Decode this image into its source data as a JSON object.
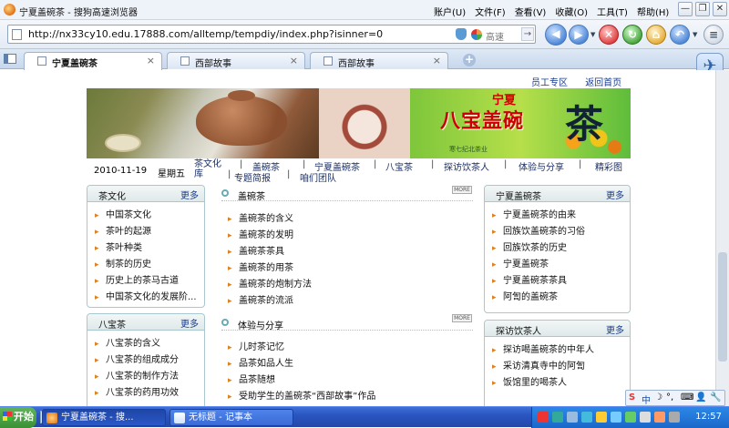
{
  "window": {
    "title": "宁夏盖碗茶 - 搜狗高速浏览器",
    "menus": [
      "账户(U)",
      "文件(F)",
      "查看(V)",
      "收藏(O)",
      "工具(T)",
      "帮助(H)"
    ],
    "controls": [
      "—",
      "❐",
      "✕"
    ]
  },
  "address": {
    "url": "http://nx33cy10.edu.17888.com/alltemp/tempdiy/index.php?isinner=0",
    "engine_label": "高速",
    "go_symbol": "→"
  },
  "nav_buttons": {
    "back": "◀",
    "forward": "▶",
    "stop": "✕",
    "refresh": "↻",
    "home": "⌂",
    "undo": "↶",
    "menu": "≡"
  },
  "tabs": [
    {
      "label": "宁夏盖碗茶",
      "close": "×"
    },
    {
      "label": "西部故事",
      "close": "×"
    },
    {
      "label": "西部故事",
      "close": "×"
    }
  ],
  "new_tab": "+",
  "top_links": [
    "员工专区",
    "返回首页"
  ],
  "banner": {
    "small_title": "宁夏",
    "name": "八宝盖碗",
    "big_char": "茶",
    "slogan": "寒七纪北茶业"
  },
  "navbar": {
    "date": "2010-11-19",
    "weekday": "星期五",
    "links": [
      "茶文化库",
      "盖碗茶",
      "宁夏盖碗茶",
      "八宝茶",
      "探访饮茶人",
      "体验与分享",
      "精彩图",
      "专题简报",
      "咱们团队"
    ]
  },
  "panels": {
    "tea_culture": {
      "title": "茶文化",
      "more": "更多",
      "items": [
        "中国茶文化",
        "茶叶的起源",
        "茶叶种类",
        "制茶的历史",
        "历史上的茶马古道",
        "中国茶文化的发展阶..."
      ]
    },
    "babao": {
      "title": "八宝茶",
      "more": "更多",
      "items": [
        "八宝茶的含义",
        "八宝茶的组成成分",
        "八宝茶的制作方法",
        "八宝茶的药用功效"
      ]
    },
    "ningxia": {
      "title": "宁夏盖碗茶",
      "more": "更多",
      "items": [
        "宁夏盖碗茶的由来",
        "回族饮盖碗茶的习俗",
        "回族饮茶的历史",
        "宁夏盖碗茶",
        "宁夏盖碗茶茶具",
        "阿訇的盖碗茶"
      ]
    },
    "visit": {
      "title": "探访饮茶人",
      "more": "更多",
      "items": [
        "探访喝盖碗茶的中年人",
        "采访清真寺中的阿訇",
        "饭馆里的喝茶人"
      ]
    }
  },
  "middle": {
    "gaiwan": {
      "title": "盖碗茶",
      "more": "MORE",
      "items": [
        "盖碗茶的含义",
        "盖碗茶的发明",
        "盖碗茶茶具",
        "盖碗茶的用茶",
        "盖碗茶的炮制方法",
        "盖碗茶的流派"
      ]
    },
    "share": {
      "title": "体验与分享",
      "more": "MORE",
      "items": [
        "儿时茶记忆",
        "品茶如品人生",
        "品茶随想",
        "受助学生的盖碗茶“西部故事”作品"
      ]
    }
  },
  "taskbar": {
    "start": "开始",
    "tasks": [
      "宁夏盖碗茶 - 搜...",
      "无标题 - 记事本"
    ],
    "clock": "12:57",
    "ime": [
      "S",
      "中",
      "☽",
      "°,",
      "⌨",
      "👤",
      "🔧"
    ]
  }
}
